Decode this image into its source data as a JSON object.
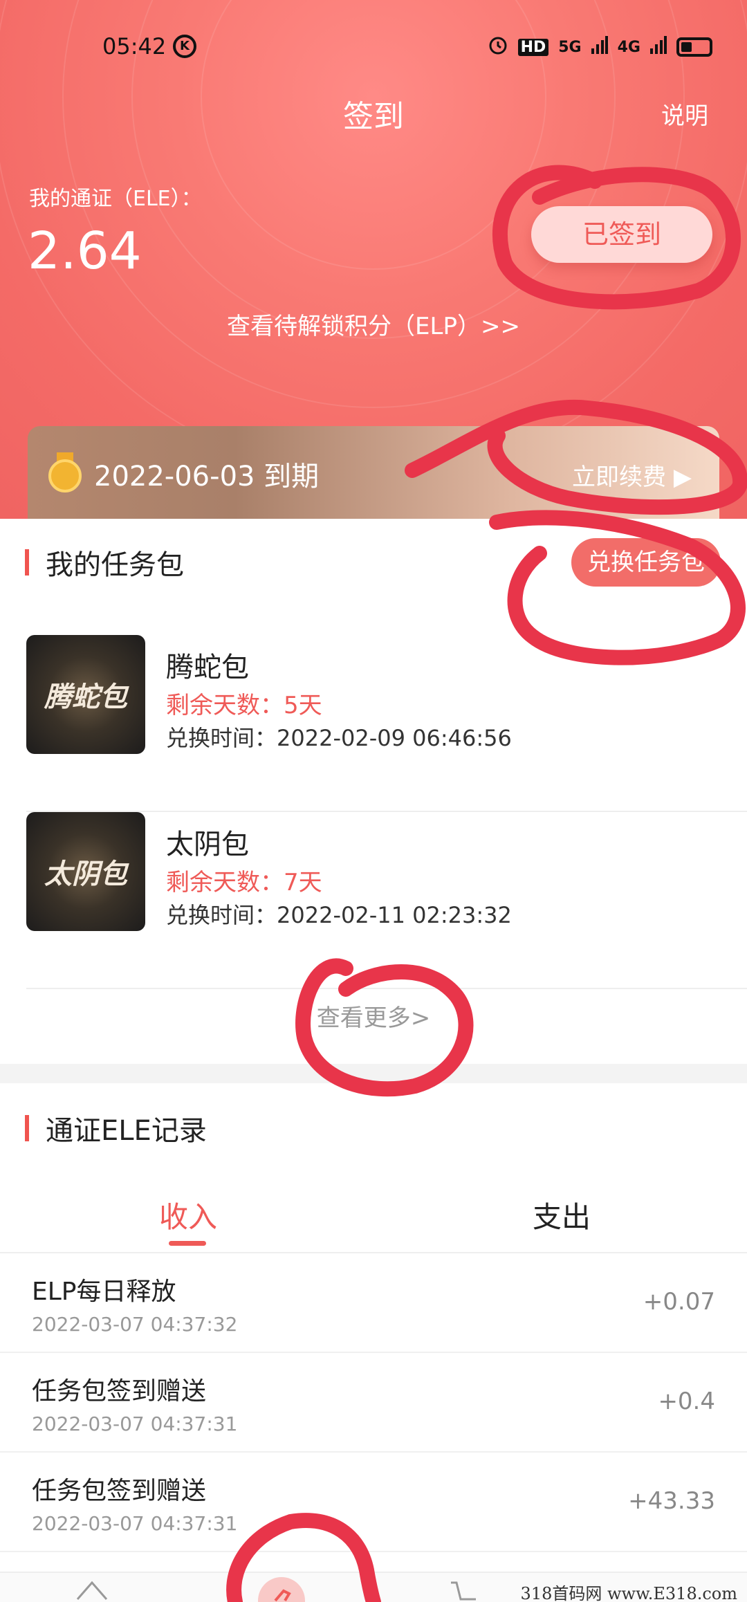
{
  "status_bar": {
    "time": "05:42",
    "k_icon": "K",
    "hd_label": "HD",
    "net1": "5G",
    "net2": "4G"
  },
  "nav": {
    "title": "签到",
    "help": "说明"
  },
  "balance": {
    "label": "我的通证（ELE）：",
    "value": "2.64"
  },
  "sign_button": "已签到",
  "elp_link": "查看待解锁积分（ELP）>>",
  "vip": {
    "expire": "2022-06-03 到期",
    "renew": "立即续费 ▶"
  },
  "task_section": {
    "title": "我的任务包",
    "exchange_button": "兑换任务包"
  },
  "packs": [
    {
      "image_text": "腾蛇包",
      "name": "腾蛇包",
      "days": "剩余天数：5天",
      "time": "兑换时间：2022-02-09 06:46:56"
    },
    {
      "image_text": "太阴包",
      "name": "太阴包",
      "days": "剩余天数：7天",
      "time": "兑换时间：2022-02-11 02:23:32"
    }
  ],
  "see_more": "查看更多>",
  "records_section": {
    "title": "通证ELE记录"
  },
  "tabs": {
    "income": "收入",
    "expense": "支出"
  },
  "records": [
    {
      "title": "ELP每日释放",
      "time": "2022-03-07 04:37:32",
      "amount": "+0.07"
    },
    {
      "title": "任务包签到赠送",
      "time": "2022-03-07 04:37:31",
      "amount": "+0.4"
    },
    {
      "title": "任务包签到赠送",
      "time": "2022-03-07 04:37:31",
      "amount": "+43.33"
    }
  ],
  "watermark": "318首码网  www.E318.com",
  "colors": {
    "accent": "#ef5a57",
    "hero": "#f46b67",
    "annotation": "#e8354a"
  }
}
